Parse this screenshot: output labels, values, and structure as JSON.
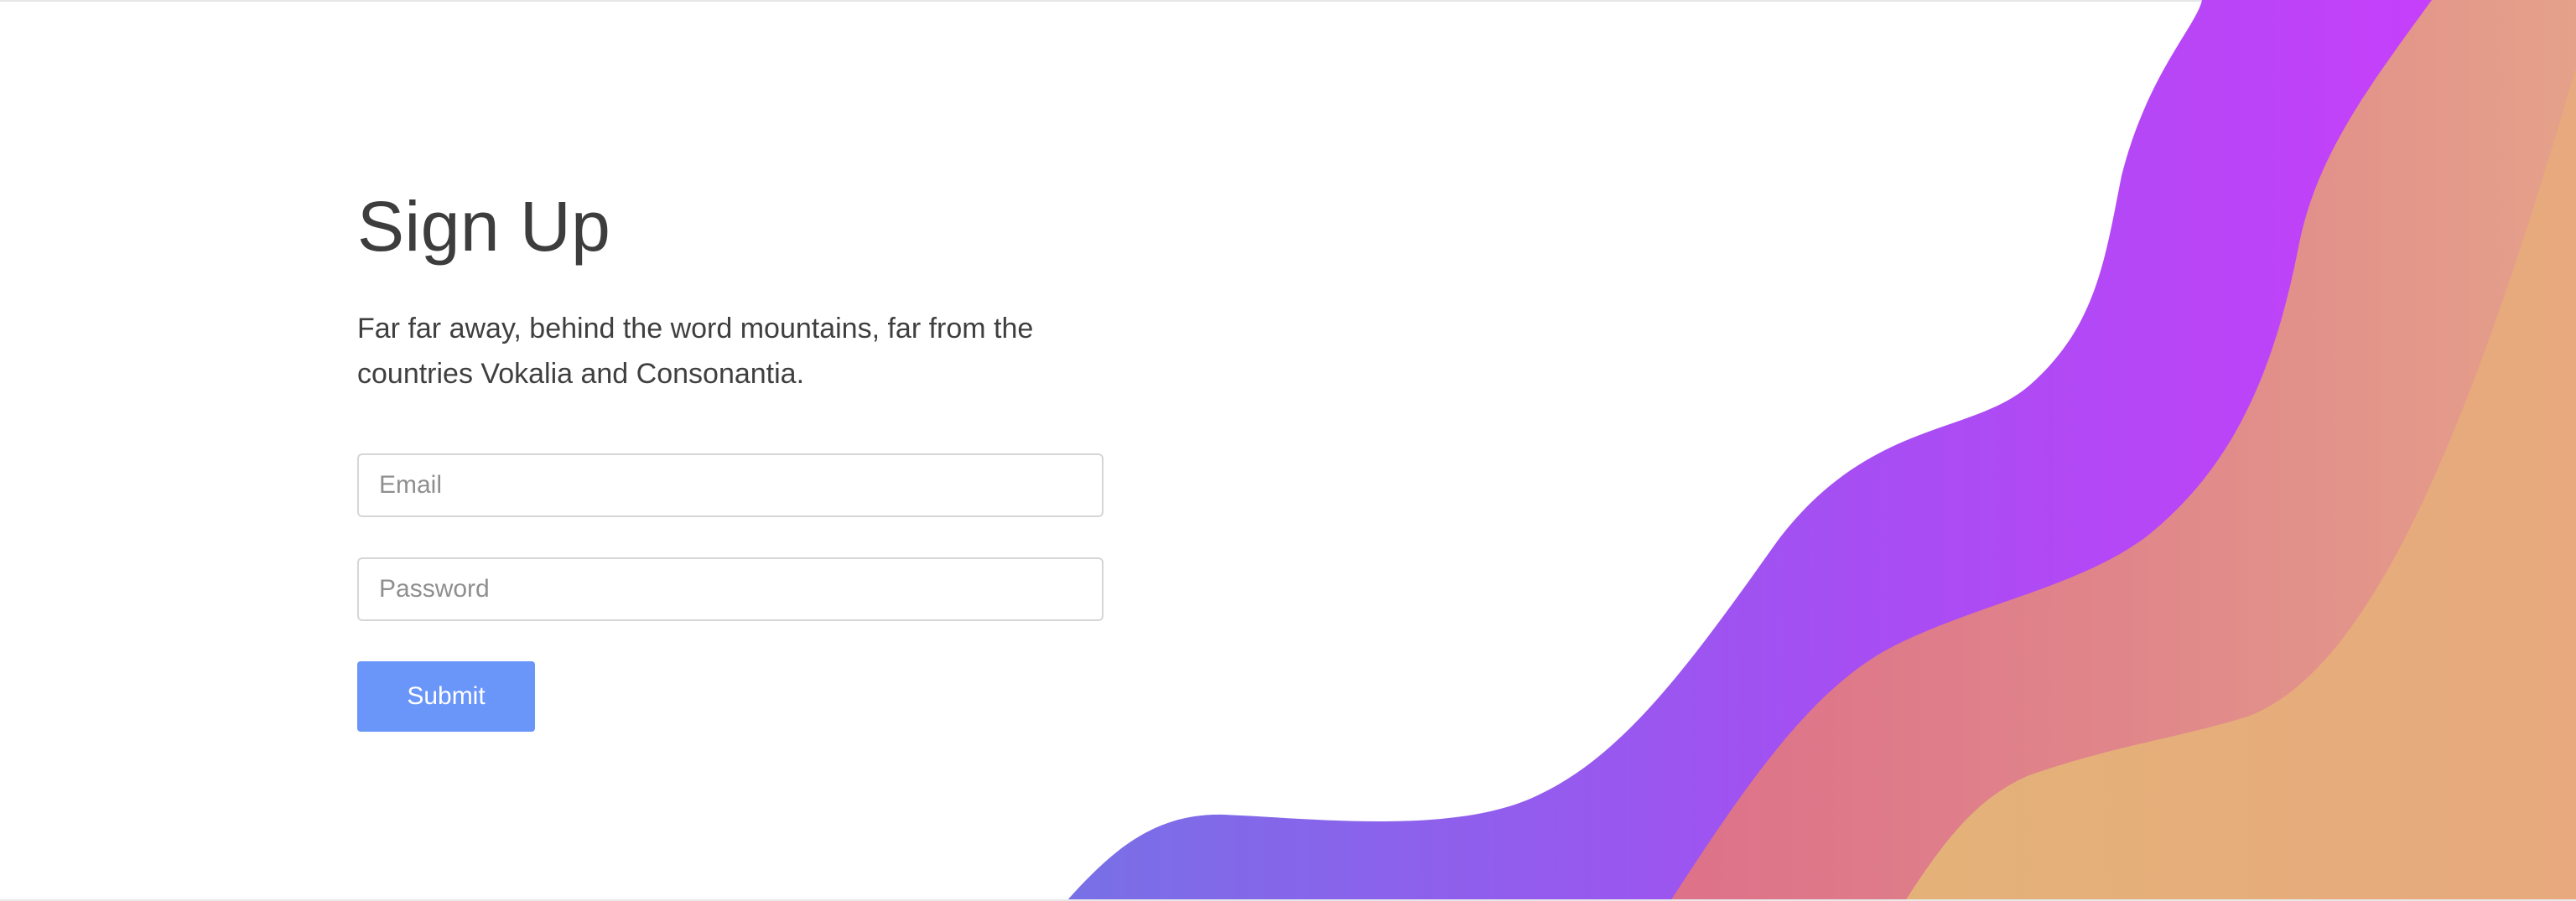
{
  "signup": {
    "title": "Sign Up",
    "subtitle": "Far far away, behind the word mountains, far from the countries Vokalia and Consonantia.",
    "email_placeholder": "Email",
    "password_placeholder": "Password",
    "submit_label": "Submit"
  },
  "colors": {
    "title_text": "#3d3d3d",
    "submit_button_bg": "#6a95f9",
    "wave_back": "#e6ad79",
    "wave_middle": "#e48a86",
    "wave_front_start": "#7a6fe6",
    "wave_front_end": "#c940fb"
  }
}
